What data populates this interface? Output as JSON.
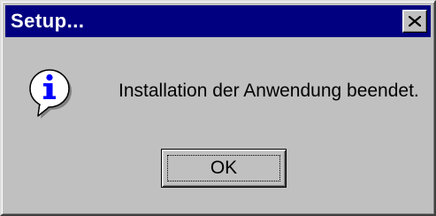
{
  "window": {
    "title": "Setup...",
    "close_glyph": "×"
  },
  "dialog": {
    "icon": "information-icon",
    "message": "Installation der Anwendung beendet.",
    "ok_label": "OK"
  },
  "colors": {
    "titlebar": "#000080",
    "face": "#c0c0c0",
    "icon_blue": "#0000ff"
  }
}
